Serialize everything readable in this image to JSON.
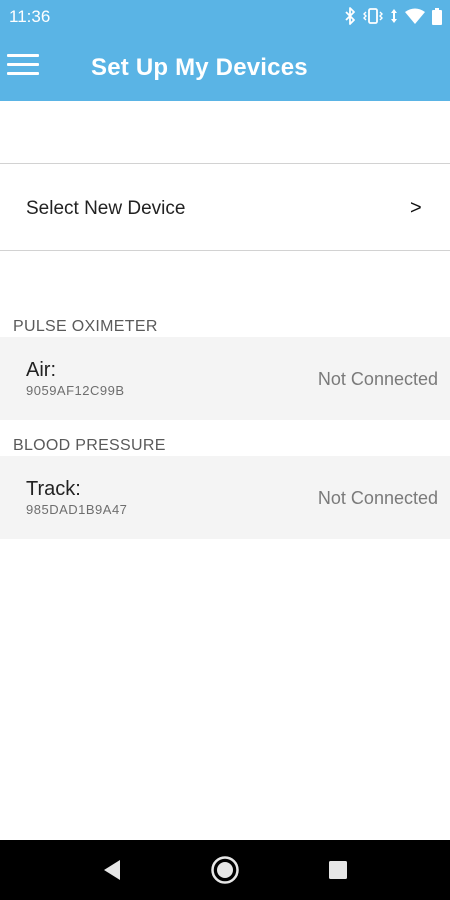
{
  "status_bar": {
    "time": "11:36",
    "icons": [
      "bluetooth-icon",
      "vibrate-icon",
      "data-arrows-icon",
      "wifi-icon",
      "battery-icon"
    ]
  },
  "toolbar": {
    "title": "Set Up My Devices",
    "menu_icon": "hamburger-menu-icon"
  },
  "select_new_device": {
    "label": "Select New Device",
    "chevron": ">"
  },
  "sections": [
    {
      "header": "PULSE OXIMETER",
      "device": {
        "name": "Air:",
        "id": "9059AF12C99B",
        "status": "Not Connected"
      }
    },
    {
      "header": "BLOOD PRESSURE",
      "device": {
        "name": "Track:",
        "id": "985DAD1B9A47",
        "status": "Not Connected"
      }
    }
  ],
  "nav_bar": {
    "buttons": [
      "back-icon",
      "home-icon",
      "recents-icon"
    ]
  },
  "colors": {
    "app_bar": "#5ab4e5",
    "row_background": "#f4f4f4",
    "nav_bar": "#000000"
  }
}
